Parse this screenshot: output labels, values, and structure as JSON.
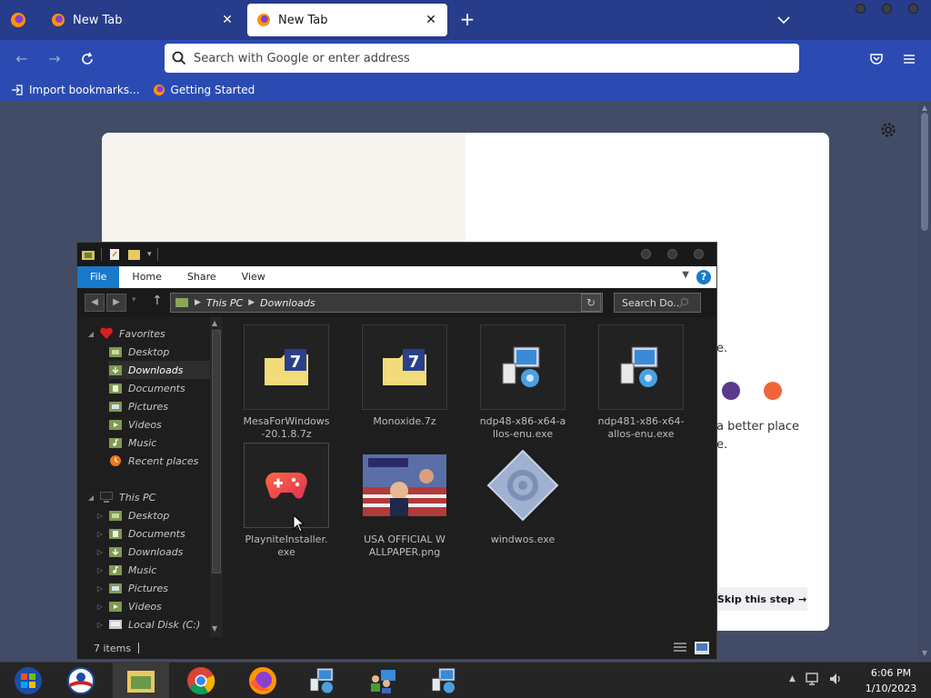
{
  "browser": {
    "tabs": [
      {
        "label": "New Tab",
        "active": false
      },
      {
        "label": "New Tab",
        "active": true
      }
    ],
    "url_placeholder": "Search with Google or enter address",
    "bookmarks": [
      {
        "label": "Import bookmarks...",
        "icon": "import-icon"
      },
      {
        "label": "Getting Started",
        "icon": "firefox-icon"
      }
    ],
    "colors": {
      "tabbar": "#273c8a",
      "navbar": "#2b4bb2",
      "accent": "#1979ca"
    }
  },
  "onboarding": {
    "subtext_1": "a better place",
    "subtext_2": "e.",
    "subtext_3": "e.",
    "skip_label": "Skip this step",
    "color_dots": [
      "#5b3a8e",
      "#f0643c"
    ]
  },
  "explorer": {
    "ribbon_tabs": [
      "File",
      "Home",
      "Share",
      "View"
    ],
    "address": [
      "This PC",
      "Downloads"
    ],
    "search_placeholder": "Search Do...",
    "nav": {
      "favorites_label": "Favorites",
      "favorites": [
        "Desktop",
        "Downloads",
        "Documents",
        "Pictures",
        "Videos",
        "Music",
        "Recent places"
      ],
      "thispc_label": "This PC",
      "thispc": [
        "Desktop",
        "Documents",
        "Downloads",
        "Music",
        "Pictures",
        "Videos",
        "Local Disk (C:)"
      ]
    },
    "files": [
      {
        "name": "MesaForWindows-20.1.8.7z",
        "icon": "7z-archive-icon"
      },
      {
        "name": "Monoxide.7z",
        "icon": "7z-archive-icon"
      },
      {
        "name": "ndp48-x86-x64-allos-enu.exe",
        "icon": "installer-icon"
      },
      {
        "name": "ndp481-x86-x64-allos-enu.exe",
        "icon": "installer-icon"
      },
      {
        "name": "PlayniteInstaller.exe",
        "icon": "gamepad-icon"
      },
      {
        "name": "USA OFFICIAL WALLPAPER.png",
        "icon": "image-thumbnail"
      },
      {
        "name": "windwos.exe",
        "icon": "exe-generic-icon"
      }
    ],
    "status": "7 items"
  },
  "taskbar": {
    "time": "6:06 PM",
    "date": "1/10/2023"
  }
}
